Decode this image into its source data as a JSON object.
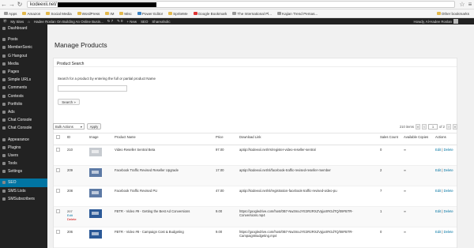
{
  "browser": {
    "url": "kodeexii.net/",
    "bookmarks": [
      {
        "label": "Apps",
        "icon": "apps-icon"
      },
      {
        "label": "Amazon",
        "icon": "folder-icon"
      },
      {
        "label": "Social Media",
        "icon": "folder-icon"
      },
      {
        "label": "WordPress",
        "icon": "folder-icon"
      },
      {
        "label": "IM",
        "icon": "folder-icon"
      },
      {
        "label": "Misc",
        "icon": "folder-icon"
      },
      {
        "label": "Power Editor",
        "icon": "folder-icon"
      },
      {
        "label": "SpriteMe",
        "icon": "folder-icon"
      },
      {
        "label": "Google Bookmark",
        "icon": "bookmark-icon"
      },
      {
        "label": "The International Pl...",
        "icon": "page-icon"
      },
      {
        "label": "Kajian Trend Pemas...",
        "icon": "page-icon"
      }
    ],
    "other_bookmarks": "Other bookmarks"
  },
  "adminbar": {
    "my_sites": "My Sites",
    "site_name": "Hadee Roslan On Building An Online Busin...",
    "items": [
      "7",
      "0",
      "New",
      "SEO",
      "Shareaholic"
    ],
    "howdy": "Howdy, Al-Hadee Roslan"
  },
  "sidebar": {
    "items": [
      "Dashboard",
      "Posts",
      "MemberSonic",
      "G Hangout",
      "Media",
      "Pages",
      "Simple URLs",
      "Comments",
      "Contests",
      "Portfolio",
      "Ads",
      "Chat Console",
      "Chat Console",
      "Appearance",
      "Plugins",
      "Users",
      "Tools",
      "Settings",
      "SEO",
      "SMS Lists",
      "SMSubscribers"
    ],
    "active": "SEO"
  },
  "page": {
    "title": "Manage Products",
    "search_heading": "Product Search",
    "search_desc": "Search for a product by entering the full or partial product Name",
    "search_placeholder": "",
    "search_button": "Search »",
    "bulk_label": "Bulk Actions",
    "apply": "Apply",
    "items_count": "210 items",
    "page_current": "1",
    "page_of": "of 2"
  },
  "table": {
    "headers": [
      "ID",
      "Image",
      "Product Name",
      "Price",
      "Download Link",
      "Sales Count",
      "Available Copies",
      "Actions"
    ],
    "rows": [
      {
        "id": "210",
        "image": "generic",
        "name": "Video Reseller Sentral Beta",
        "price": "97.00",
        "link": "aptip://kodeexii.net/rrs/register-video-reseller-sentral",
        "sales": "0",
        "copies": "∞",
        "act1": "Edit",
        "act2": "Delete",
        "extra": ""
      },
      {
        "id": "209",
        "image": "fb",
        "name": "Facebook Traffic Revised Reseller Upgrade",
        "price": "17.00",
        "link": "aptip://kodeexii.net/nl/facebook-traffic-revised-reseller-member",
        "sales": "2",
        "copies": "∞",
        "act1": "Edit",
        "act2": "Delete",
        "extra": ""
      },
      {
        "id": "208",
        "image": "fb",
        "name": "Facebook Traffic Revised PU",
        "price": "47.00",
        "link": "aptip://kodeexii.net/nl/registration-facebook-traffic-revised-video-pu",
        "sales": "7",
        "copies": "∞",
        "act1": "Edit",
        "act2": "Delete",
        "extra": ""
      },
      {
        "id": "207",
        "image": "ps",
        "name": "FBTR - Video #9 - Getting the Best Ad Conversions",
        "price": "9.00",
        "link": "https://googledrive.com/host/0B7-Nw3mxJYE3R2RXZVpjaXRGdTQ/09FBTR-Conversions.mp4",
        "sales": "1",
        "copies": "∞",
        "act1": "Edit",
        "act2": "Delete",
        "extra": "Edit"
      },
      {
        "id": "206",
        "image": "ps",
        "name": "FBTR - Video #8 - Campaign Cost & Budgeting",
        "price": "9.00",
        "link": "https://googledrive.com/host/0B7-Nw3mxJYE3R2RXZVpjaXRGdTQ/08FBTR-CampaignBudgeting.mp4",
        "sales": "0",
        "copies": "∞",
        "act1": "Edit",
        "act2": "Delete",
        "extra": ""
      }
    ]
  }
}
